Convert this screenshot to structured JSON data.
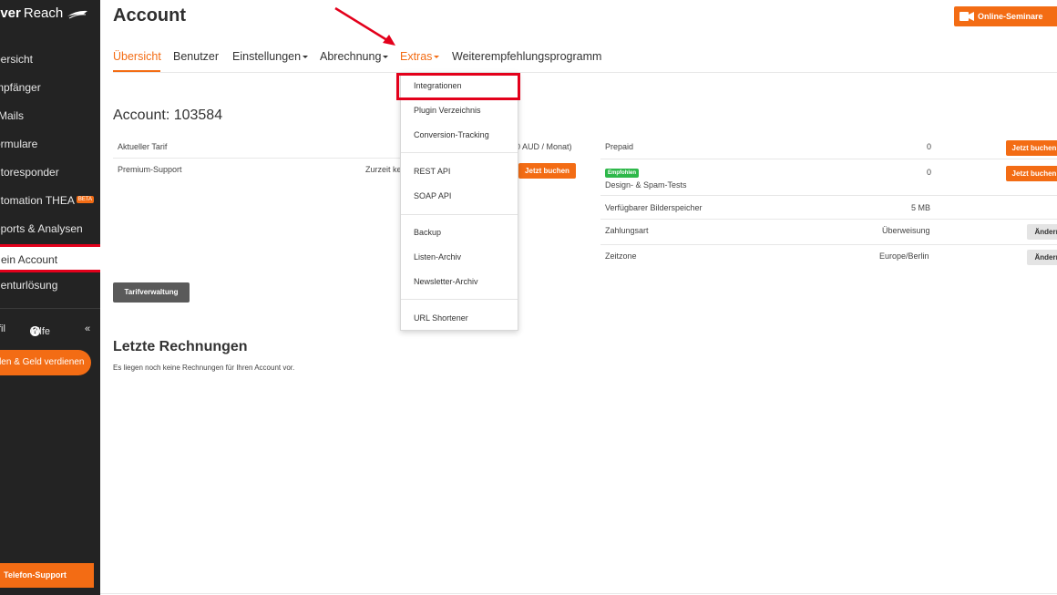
{
  "sidebar": {
    "logo_bold": "ever",
    "logo_light": "Reach",
    "items": [
      {
        "label": "bersicht"
      },
      {
        "label": "mpfänger"
      },
      {
        "label": "-Mails"
      },
      {
        "label": "ormulare"
      },
      {
        "label": "utoresponder"
      },
      {
        "label": "utomation THEA",
        "badge": "BETA"
      },
      {
        "label": "eports & Analysen"
      },
      {
        "label": "ein Account"
      },
      {
        "label": "genturlösung"
      }
    ],
    "profile_label": "fil",
    "help_label": "Hilfe",
    "collapse_label": "«",
    "earn_button": "hlen & Geld verdienen",
    "phone_button": "Telefon-Support"
  },
  "header": {
    "title": "Account",
    "seminar_button": "Online-Seminare"
  },
  "tabs": [
    {
      "label": "Übersicht",
      "active": true
    },
    {
      "label": "Benutzer"
    },
    {
      "label": "Einstellungen",
      "caret": true
    },
    {
      "label": "Abrechnung",
      "caret": true
    },
    {
      "label": "Extras",
      "caret": true,
      "open": true
    },
    {
      "label": "Weiterempfehlungsprogramm"
    }
  ],
  "account": {
    "title": "Account: 103584",
    "left_rows": [
      {
        "label": "Aktueller Tarif",
        "value": "0 AUD / Monat)"
      },
      {
        "label": "Premium-Support",
        "value": "Zurzeit ke",
        "button": "Jetzt buchen"
      }
    ],
    "right_rows": [
      {
        "label": "Prepaid",
        "value": "0",
        "button": "Jetzt buchen"
      },
      {
        "badge": "Empfohlen",
        "label": "Design- & Spam-Tests",
        "value": "0",
        "button": "Jetzt buchen"
      },
      {
        "label": "Verfügbarer Bilderspeicher",
        "value": "5 MB"
      },
      {
        "label": "Zahlungsart",
        "value": "Überweisung",
        "button": "Ändern"
      },
      {
        "label": "Zeitzone",
        "value": "Europe/Berlin",
        "button": "Ändern"
      }
    ],
    "tarif_button": "Tarifverwaltung"
  },
  "invoices": {
    "title": "Letzte Rechnungen",
    "empty_text": "Es liegen noch keine Rechnungen für Ihren Account vor."
  },
  "extras_menu": {
    "groups": [
      [
        "Integrationen",
        "Plugin Verzeichnis",
        "Conversion-Tracking"
      ],
      [
        "REST API",
        "SOAP API"
      ],
      [
        "Backup",
        "Listen-Archiv",
        "Newsletter-Archiv"
      ],
      [
        "URL Shortener"
      ]
    ],
    "highlighted": "Integrationen"
  },
  "colors": {
    "accent": "#f36c14",
    "sidebar_bg": "#232323",
    "annotation_red": "#e3001b",
    "badge_green": "#2eb84a"
  }
}
